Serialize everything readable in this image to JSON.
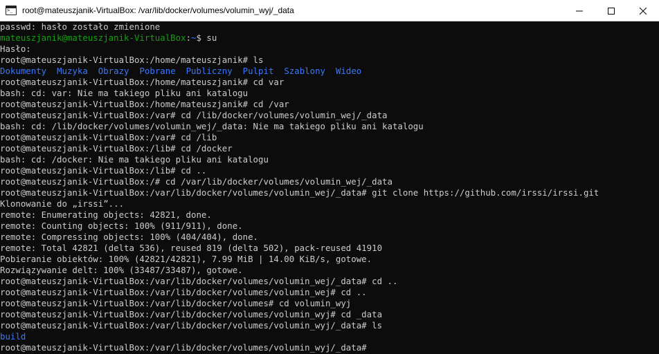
{
  "window": {
    "title": "root@mateuszjanik-VirtualBox: /var/lib/docker/volumes/volumin_wyj/_data",
    "app_icon": "terminal-icon",
    "controls": [
      "minimize-icon",
      "maximize-icon",
      "close-icon"
    ]
  },
  "colors": {
    "background": "#0c0c0c",
    "text": "#cccccc",
    "prompt_user": "#13a10e",
    "prompt_path": "#3b78ff",
    "directory": "#3b78ff"
  },
  "terminal": {
    "line0": "passwd: hasło zostało zmienione",
    "line1_user": "mateuszjanik@mateuszjanik-VirtualBox",
    "line1_sep": ":",
    "line1_path": "~",
    "line1_cmd": "$ su",
    "line2": "Hasło:",
    "line3": "root@mateuszjanik-VirtualBox:/home/mateuszjanik# ls",
    "ls_dirs": [
      "Dokumenty",
      "Muzyka",
      "Obrazy",
      "Pobrane",
      "Publiczny",
      "Pulpit",
      "Szablony",
      "Wideo"
    ],
    "line5": "root@mateuszjanik-VirtualBox:/home/mateuszjanik# cd var",
    "line6": "bash: cd: var: Nie ma takiego pliku ani katalogu",
    "line7": "root@mateuszjanik-VirtualBox:/home/mateuszjanik# cd /var",
    "line8": "root@mateuszjanik-VirtualBox:/var# cd /lib/docker/volumes/volumin_wej/_data",
    "line9": "bash: cd: /lib/docker/volumes/volumin_wej/_data: Nie ma takiego pliku ani katalogu",
    "line10": "root@mateuszjanik-VirtualBox:/var# cd /lib",
    "line11": "root@mateuszjanik-VirtualBox:/lib# cd /docker",
    "line12": "bash: cd: /docker: Nie ma takiego pliku ani katalogu",
    "line13": "root@mateuszjanik-VirtualBox:/lib# cd ..",
    "line14": "root@mateuszjanik-VirtualBox:/# cd /var/lib/docker/volumes/volumin_wej/_data",
    "line15": "root@mateuszjanik-VirtualBox:/var/lib/docker/volumes/volumin_wej/_data# git clone https://github.com/irssi/irssi.git",
    "line16": "Klonowanie do „irssi”...",
    "line17": "remote: Enumerating objects: 42821, done.",
    "line18": "remote: Counting objects: 100% (911/911), done.",
    "line19": "remote: Compressing objects: 100% (404/404), done.",
    "line20": "remote: Total 42821 (delta 536), reused 819 (delta 502), pack-reused 41910",
    "line21": "Pobieranie obiektów: 100% (42821/42821), 7.99 MiB | 14.00 KiB/s, gotowe.",
    "line22": "Rozwiązywanie delt: 100% (33487/33487), gotowe.",
    "line23": "root@mateuszjanik-VirtualBox:/var/lib/docker/volumes/volumin_wej/_data# cd ..",
    "line24": "root@mateuszjanik-VirtualBox:/var/lib/docker/volumes/volumin_wej# cd ..",
    "line25": "root@mateuszjanik-VirtualBox:/var/lib/docker/volumes# cd volumin_wyj",
    "line26": "root@mateuszjanik-VirtualBox:/var/lib/docker/volumes/volumin_wyj# cd _data",
    "line27": "root@mateuszjanik-VirtualBox:/var/lib/docker/volumes/volumin_wyj/_data# ls",
    "line28_dir": "build",
    "line29": "root@mateuszjanik-VirtualBox:/var/lib/docker/volumes/volumin_wyj/_data#"
  }
}
